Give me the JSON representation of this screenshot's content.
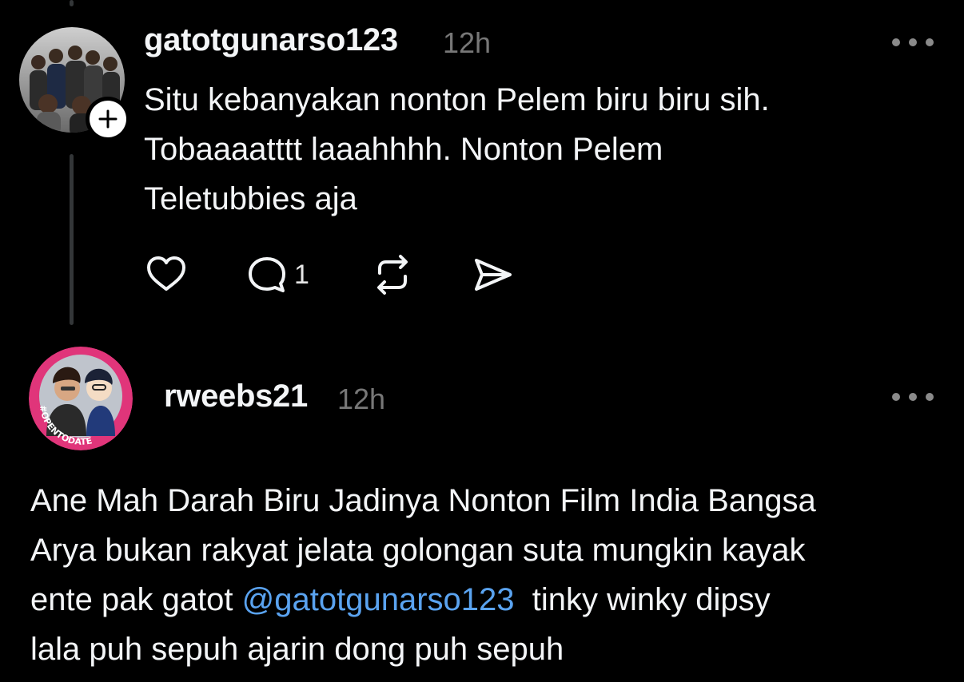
{
  "posts": [
    {
      "username": "gatotgunarso123",
      "time": "12h",
      "text": "Situ kebanyakan nonton Pelem biru biru sih.\nTobaaaatttt laaahhhh. Nonton Pelem\nTeletubbies aja",
      "avatar_icon": "group-photo-avatar",
      "follow_icon": "plus-icon",
      "actions": {
        "like_icon": "heart-icon",
        "reply_icon": "comment-icon",
        "reply_count": "1",
        "repost_icon": "repost-icon",
        "share_icon": "send-icon"
      }
    },
    {
      "username": "rweebs21",
      "time": "12h",
      "text_parts": {
        "before": "Ane Mah Darah Biru Jadinya Nonton Film India Bangsa\nArya bukan rakyat jelata golongan suta mungkin kayak\nente pak gatot ",
        "mention": "@gatotgunarso123",
        "after": "  tinky winky dipsy\nlala puh sepuh ajarin dong puh sepuh"
      },
      "avatar_icon": "open-to-date-avatar",
      "avatar_badge_text": "#OPENTODATE"
    }
  ],
  "colors": {
    "background": "#000000",
    "text": "#f3f5f7",
    "muted": "#777777",
    "mention": "#5aa3f0",
    "avatar_ring": "#e0357a"
  }
}
